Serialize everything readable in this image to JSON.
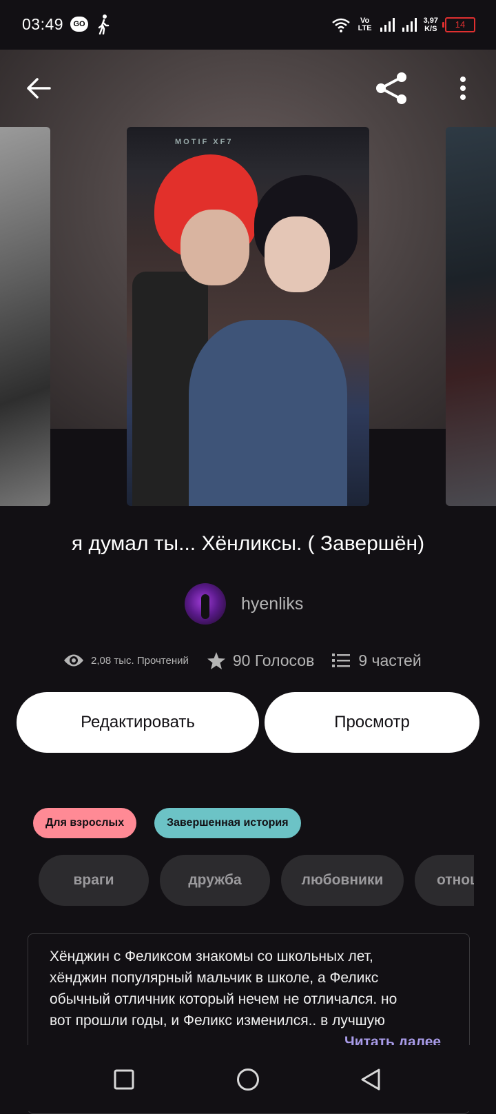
{
  "status_bar": {
    "time": "03:49",
    "app_badge": "GO",
    "network_label": "Vo LTE",
    "speed_value": "3,97",
    "speed_unit": "K/S",
    "battery": "14"
  },
  "header": {
    "back_icon": "arrow-left-icon",
    "share_icon": "share-icon",
    "more_icon": "more-vertical-icon"
  },
  "cover": {
    "banner_text": "MOTIF XF7"
  },
  "story": {
    "title": "я думал ты... Хёнликсы. ( Завершён)",
    "author": "hyenliks",
    "stats": {
      "reads": "2,08 тыс. Прочтений",
      "votes": "90 Голосов",
      "parts": "9 частей"
    }
  },
  "actions": {
    "edit_label": "Редактировать",
    "view_label": "Просмотр"
  },
  "badges": {
    "mature": "Для взрослых",
    "complete": "Завершенная история"
  },
  "tags": [
    "враги",
    "дружба",
    "любовники",
    "отношения"
  ],
  "description": {
    "line1": "Хёнджин с Феликсом знакомы со школьных лет,",
    "line2": "хёнджин популярный мальчик в школе, а Феликс",
    "line3": "обычный отличник который нечем не отличался. но",
    "line4": "вот прошли годы, и Феликс изменился.. в лучшую",
    "read_more": "Читать далее"
  },
  "colors": {
    "background": "#121014",
    "mature_badge": "#ff8a95",
    "complete_badge": "#6cc3c6",
    "read_more": "#a89be8",
    "tag_bg": "#2c2b2e"
  }
}
